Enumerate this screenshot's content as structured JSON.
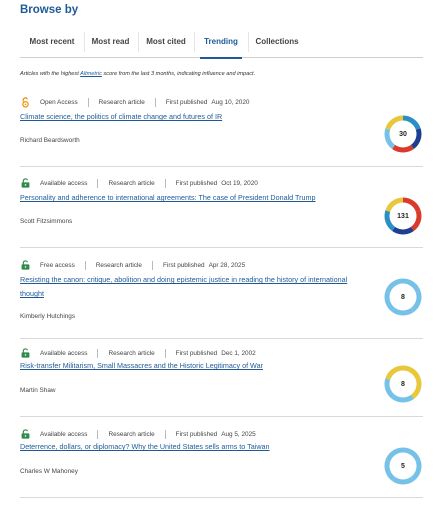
{
  "browse_title": "Browse by",
  "tabs": [
    {
      "label": "Most recent",
      "active": false
    },
    {
      "label": "Most read",
      "active": false
    },
    {
      "label": "Most cited",
      "active": false
    },
    {
      "label": "Trending",
      "active": true
    },
    {
      "label": "Collections",
      "active": false
    }
  ],
  "note": {
    "before": "Articles with the highest ",
    "link": "Altmetric",
    "after": " score from the last 3 months, indicating influence and impact."
  },
  "first_published_label": "First published",
  "articles": [
    {
      "access": "Open Access",
      "access_icon": "open-access-icon",
      "type": "Research article",
      "date": "Aug 10, 2020",
      "title": "Climate science, the politics of climate change and futures of IR",
      "author": "Richard Beardsworth",
      "score": "30",
      "score_colors": [
        "#2b8fc4",
        "#1e3f8f",
        "#d93a2b",
        "#76c1e8",
        "#e8c73a"
      ]
    },
    {
      "access": "Available access",
      "access_icon": "unlocked-icon",
      "type": "Research article",
      "date": "Oct 19, 2020",
      "title": "Personality and adherence to international agreements: The case of President Donald Trump",
      "author": "Scott Fitzsimmons",
      "score": "131",
      "score_colors": [
        "#d93a2b",
        "#d93a2b",
        "#1e3f8f",
        "#2b8fc4",
        "#e8c73a"
      ]
    },
    {
      "access": "Free access",
      "access_icon": "unlocked-icon",
      "type": "Research article",
      "date": "Apr 28, 2025",
      "title": "Resisting the canon: critique, abolition and doing epistemic justice in reading the history of international thought",
      "author": "Kimberly Hutchings",
      "score": "8",
      "score_colors": [
        "#76c1e8",
        "#76c1e8",
        "#76c1e8",
        "#76c1e8",
        "#76c1e8"
      ]
    },
    {
      "access": "Available access",
      "access_icon": "unlocked-icon",
      "type": "Research article",
      "date": "Dec 1, 2002",
      "title": "Risk-transfer Militarism, Small Massacres and the Historic Legitimacy of War",
      "author": "Martin Shaw",
      "score": "8",
      "score_colors": [
        "#e8c73a",
        "#e8c73a",
        "#76c1e8",
        "#76c1e8",
        "#e8c73a"
      ]
    },
    {
      "access": "Available access",
      "access_icon": "unlocked-icon",
      "type": "Research article",
      "date": "Aug 5, 2025",
      "title": "Deterrence, dollars, or diplomacy? Why the United States sells arms to Taiwan",
      "author": "Charles W Mahoney",
      "score": "5",
      "score_colors": [
        "#76c1e8",
        "#76c1e8",
        "#76c1e8",
        "#76c1e8",
        "#76c1e8"
      ]
    }
  ]
}
